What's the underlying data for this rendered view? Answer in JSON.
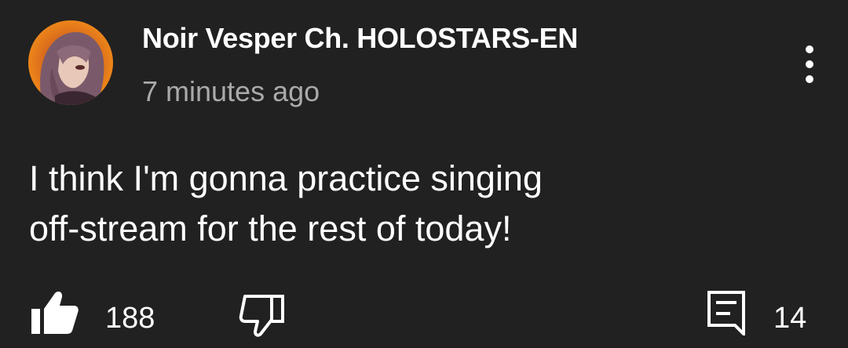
{
  "comment": {
    "author": "Noir Vesper Ch. HOLOSTARS-EN",
    "timestamp": "7 minutes ago",
    "text": "I think I'm gonna practice singing\noff-stream for the rest of today!"
  },
  "actions": {
    "like_count": "188",
    "reply_count": "14"
  },
  "icons": {
    "like": "thumbs-up-icon",
    "dislike": "thumbs-down-icon",
    "reply": "comment-icon",
    "menu": "more-vertical-icon"
  },
  "colors": {
    "background": "#212121",
    "text": "#ffffff",
    "secondary_text": "#aaaaaa"
  }
}
